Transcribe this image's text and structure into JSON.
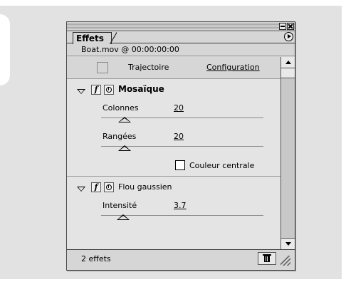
{
  "panel": {
    "tab_label": "Effets",
    "clip_info": "Boat.mov @ 00:00:00:00"
  },
  "header": {
    "trajectory_label": "Trajectoire",
    "configuration_label": "Configuration"
  },
  "effects": [
    {
      "name": "Mosaïque",
      "fx_glyph": "f",
      "expanded": true,
      "params": [
        {
          "label": "Colonnes",
          "value": "20"
        },
        {
          "label": "Rangées",
          "value": "20"
        }
      ],
      "checkbox": {
        "label": "Couleur centrale",
        "checked": false
      }
    },
    {
      "name": "Flou gaussien",
      "fx_glyph": "f",
      "expanded": true,
      "params": [
        {
          "label": "Intensité",
          "value": "3.7"
        }
      ]
    }
  ],
  "status": {
    "count_text": "2 effets"
  },
  "icons": {
    "close": "close-icon",
    "minimize": "minimize-icon",
    "menu": "palette-menu-icon",
    "twirl": "triangle-down-icon",
    "fx": "fx-icon",
    "stopwatch": "stopwatch-icon",
    "trash": "trash-icon"
  }
}
